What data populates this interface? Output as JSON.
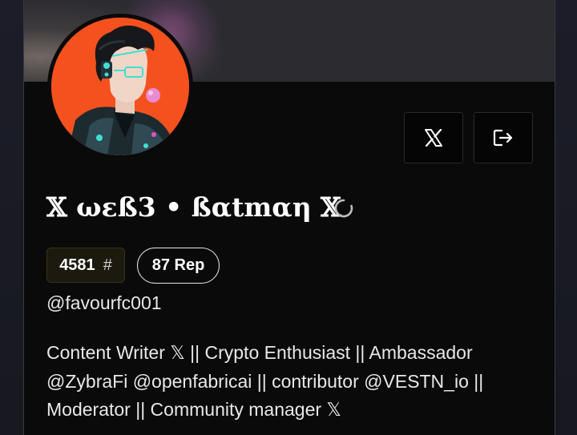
{
  "profile": {
    "display_name": "𝕏 ωεß3 • ßαtmαη 𝕏",
    "rank_value": "4581",
    "rank_symbol": "#",
    "reputation": "87 Rep",
    "handle": "@favourfc001",
    "bio_lines": [
      "Content Writer 𝕏 || Crypto Enthusiast || Ambassador",
      "@ZybraFi @openfabricai || contributor @VESTN_io ||",
      "Moderator || Community manager 𝕏"
    ]
  },
  "actions": {
    "x_button_icon": "x-logo-icon",
    "logout_button_icon": "logout-icon"
  },
  "avatar": {
    "icon": "anime-avatar",
    "background_color": "#f4511e"
  },
  "colors": {
    "card_background": "#0a0a0b",
    "banner": "#2b2b30",
    "text": "#ffffff",
    "rank_pill_background": "#1c190f"
  }
}
